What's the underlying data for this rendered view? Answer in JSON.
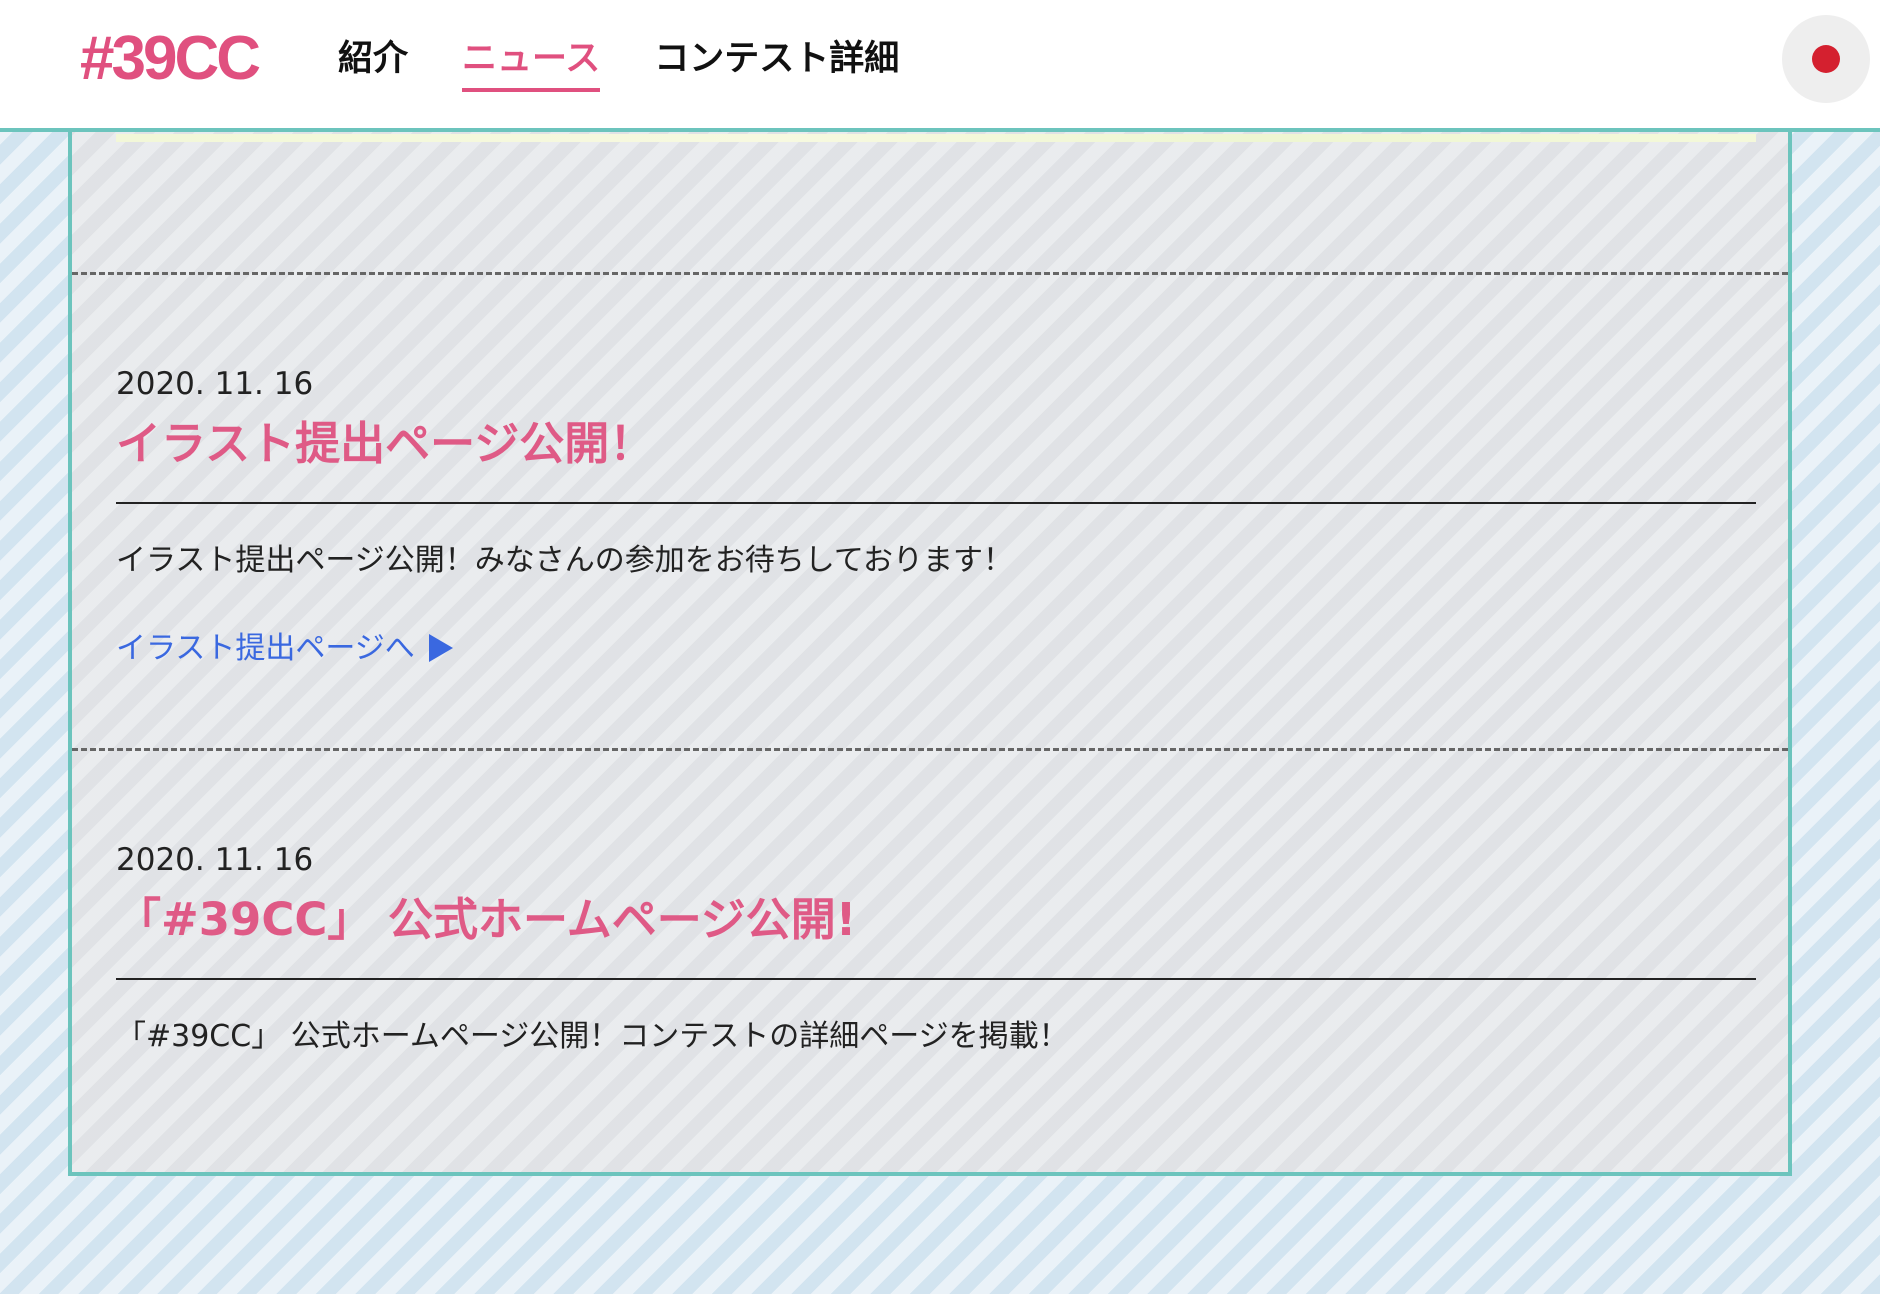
{
  "header": {
    "logo": "#39CC",
    "nav": [
      {
        "label": "紹介",
        "active": false
      },
      {
        "label": "ニュース",
        "active": true
      },
      {
        "label": "コンテスト詳細",
        "active": false
      }
    ],
    "lang_icon": "japan-flag-icon",
    "accent_color": "#e0507f",
    "border_color": "#6cc4bd"
  },
  "news": [
    {
      "date": "2020. 11. 16",
      "title": "イラスト提出ページ公開！",
      "body": "イラスト提出ページ公開！みなさんの参加をお待ちしております！",
      "link_label": "イラスト提出ページへ",
      "link_icon": "triangle-right-icon"
    },
    {
      "date": "2020. 11. 16",
      "title": "「#39CC」 公式ホームページ公開!",
      "body": "「#39CC」 公式ホームページ公開！コンテストの詳細ページを掲載！"
    }
  ]
}
